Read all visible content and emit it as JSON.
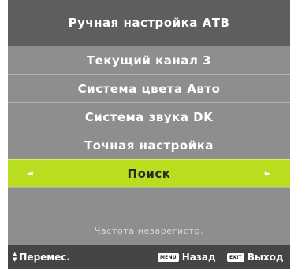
{
  "menu": {
    "title": "Ручная настройка АТВ",
    "items": [
      {
        "label": "Текущий канал 3"
      },
      {
        "label": "Система цвета Авто"
      },
      {
        "label": "Система звука DK"
      },
      {
        "label": "Точная настройка"
      },
      {
        "label": "Поиск",
        "selected": true
      }
    ],
    "hint": "Частота незарегистр.",
    "arrow_left": "◄",
    "arrow_right": "►"
  },
  "footer": {
    "move_label": "Перемес.",
    "menu_key": "MENU",
    "back_label": "Назад",
    "exit_key": "EXIT",
    "exit_label": "Выход"
  },
  "colors": {
    "panel": "#8e8e8e",
    "title_bar": "#5e5e5e",
    "selected": "#b9de1f",
    "footer": "#454545"
  }
}
